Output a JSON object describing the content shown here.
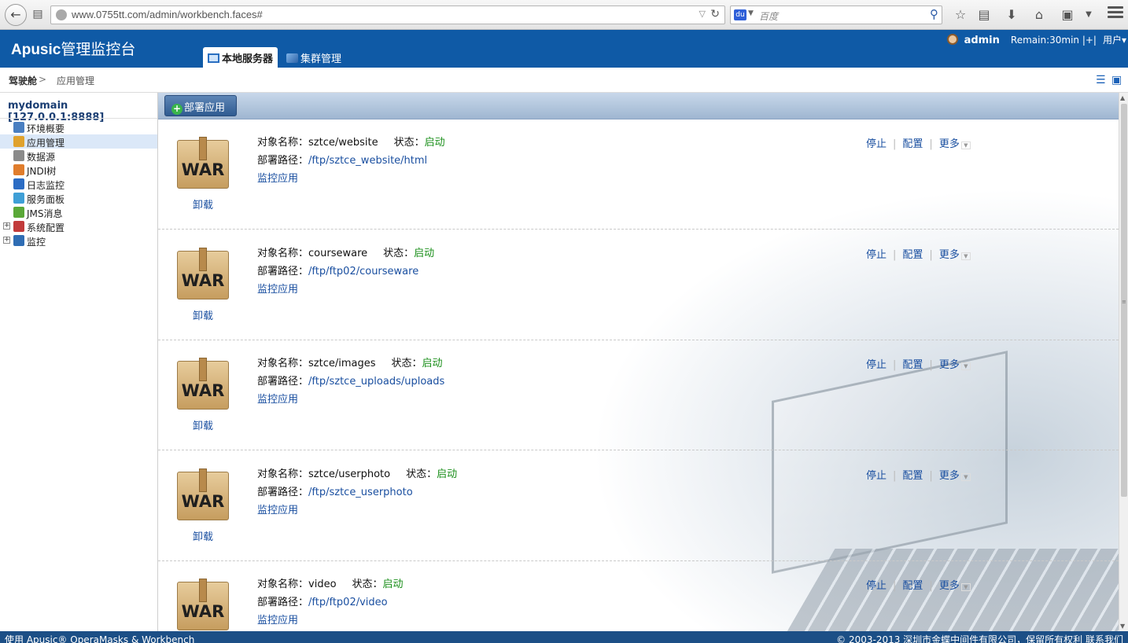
{
  "browser": {
    "url": "www.0755tt.com/admin/workbench.faces#",
    "search_placeholder": "百度"
  },
  "header": {
    "logo_bold": "Apusic",
    "logo_rest": "管理监控台",
    "tabs": [
      {
        "label": "本地服务器",
        "active": true
      },
      {
        "label": "集群管理",
        "active": false
      }
    ],
    "user": "admin",
    "remain": "Remain:30min |+|",
    "users_menu": "用户▾"
  },
  "breadcrumb": {
    "root": "驾驶舱",
    "separator": ">",
    "current": "应用管理"
  },
  "sidebar": {
    "domain": "mydomain [127.0.0.1:8888]",
    "items": [
      {
        "label": "环境概要",
        "icon": "#4a7fc1",
        "expandable": false,
        "selected": false
      },
      {
        "label": "应用管理",
        "icon": "#e0a22d",
        "expandable": false,
        "selected": true
      },
      {
        "label": "数据源",
        "icon": "#8a8a8a",
        "expandable": false,
        "selected": false
      },
      {
        "label": "JNDI树",
        "icon": "#e07d2d",
        "expandable": false,
        "selected": false
      },
      {
        "label": "日志监控",
        "icon": "#2b6cc4",
        "expandable": false,
        "selected": false
      },
      {
        "label": "服务面板",
        "icon": "#3f9fd6",
        "expandable": false,
        "selected": false
      },
      {
        "label": "JMS消息",
        "icon": "#5aa838",
        "expandable": false,
        "selected": false
      },
      {
        "label": "系统配置",
        "icon": "#c23b3b",
        "expandable": true,
        "selected": false
      },
      {
        "label": "监控",
        "icon": "#2f6db4",
        "expandable": true,
        "selected": false
      }
    ]
  },
  "toolbar": {
    "deploy_label": "部署应用"
  },
  "labels": {
    "name": "对象名称：",
    "status": "状态：",
    "path": "部署路径：",
    "monitor": "监控应用",
    "uninstall": "卸载",
    "war": "WAR",
    "stop": "停止",
    "config": "配置",
    "more": "更多"
  },
  "apps": [
    {
      "name": "sztce/website",
      "status": "启动",
      "path": "/ftp/sztce_website/html"
    },
    {
      "name": "courseware",
      "status": "启动",
      "path": "/ftp/ftp02/courseware"
    },
    {
      "name": "sztce/images",
      "status": "启动",
      "path": "/ftp/sztce_uploads/uploads"
    },
    {
      "name": "sztce/userphoto",
      "status": "启动",
      "path": "/ftp/sztce_userphoto"
    },
    {
      "name": "video",
      "status": "启动",
      "path": "/ftp/ftp02/video"
    }
  ],
  "footer": {
    "left": "使用 Apusic® OperaMasks & Workbench",
    "right": "© 2003-2013 深圳市金蝶中间件有限公司，保留所有权利    联系我们"
  }
}
